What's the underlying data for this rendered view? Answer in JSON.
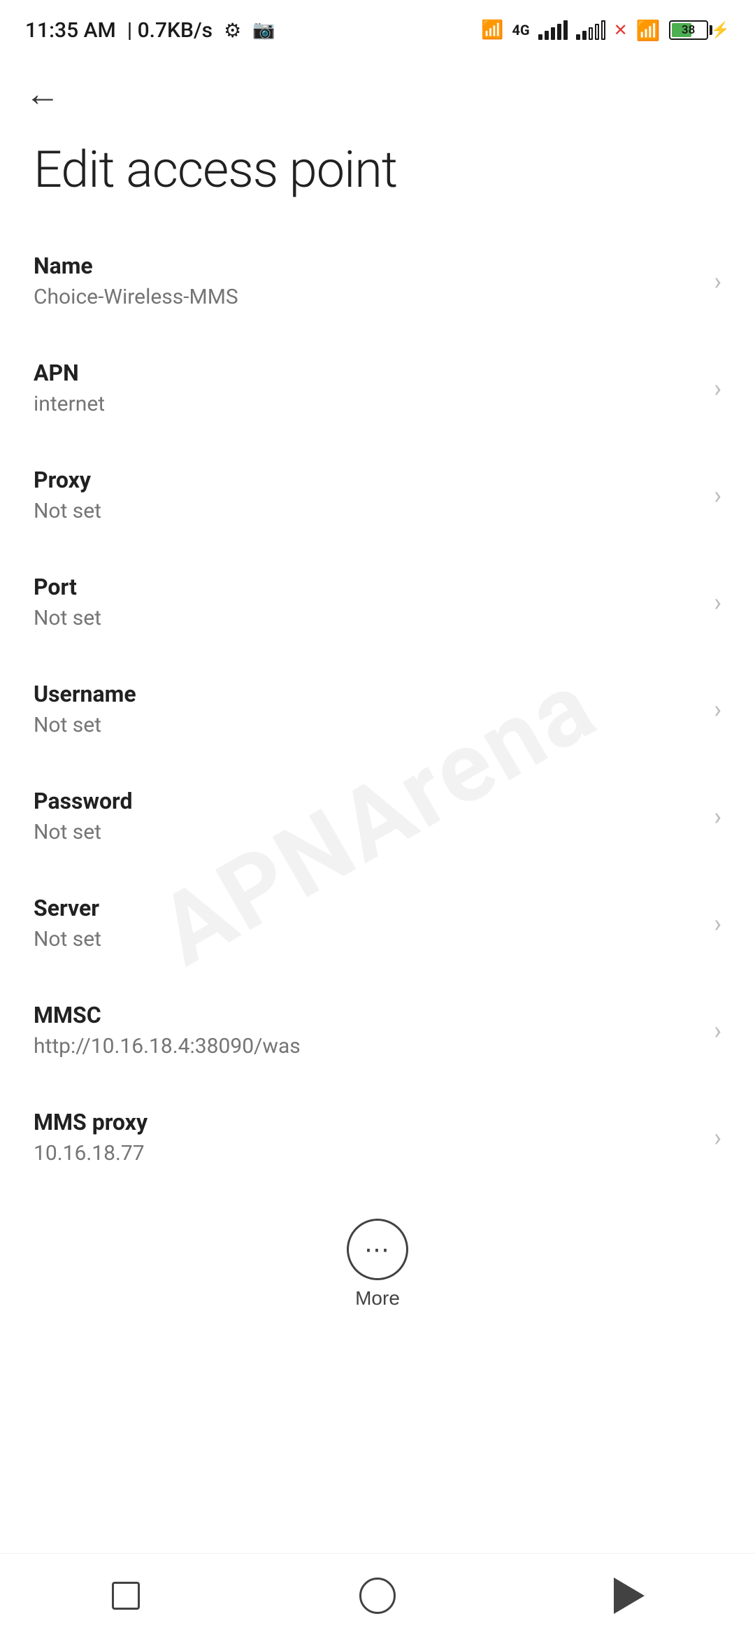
{
  "statusBar": {
    "time": "11:35 AM",
    "speed": "0.7KB/s"
  },
  "toolbar": {
    "backLabel": "←"
  },
  "page": {
    "title": "Edit access point"
  },
  "settings": [
    {
      "label": "Name",
      "value": "Choice-Wireless-MMS"
    },
    {
      "label": "APN",
      "value": "internet"
    },
    {
      "label": "Proxy",
      "value": "Not set"
    },
    {
      "label": "Port",
      "value": "Not set"
    },
    {
      "label": "Username",
      "value": "Not set"
    },
    {
      "label": "Password",
      "value": "Not set"
    },
    {
      "label": "Server",
      "value": "Not set"
    },
    {
      "label": "MMSC",
      "value": "http://10.16.18.4:38090/was"
    },
    {
      "label": "MMS proxy",
      "value": "10.16.18.77"
    }
  ],
  "more": {
    "label": "More"
  },
  "battery": {
    "percent": "38"
  },
  "watermark": {
    "text": "APNArena"
  }
}
